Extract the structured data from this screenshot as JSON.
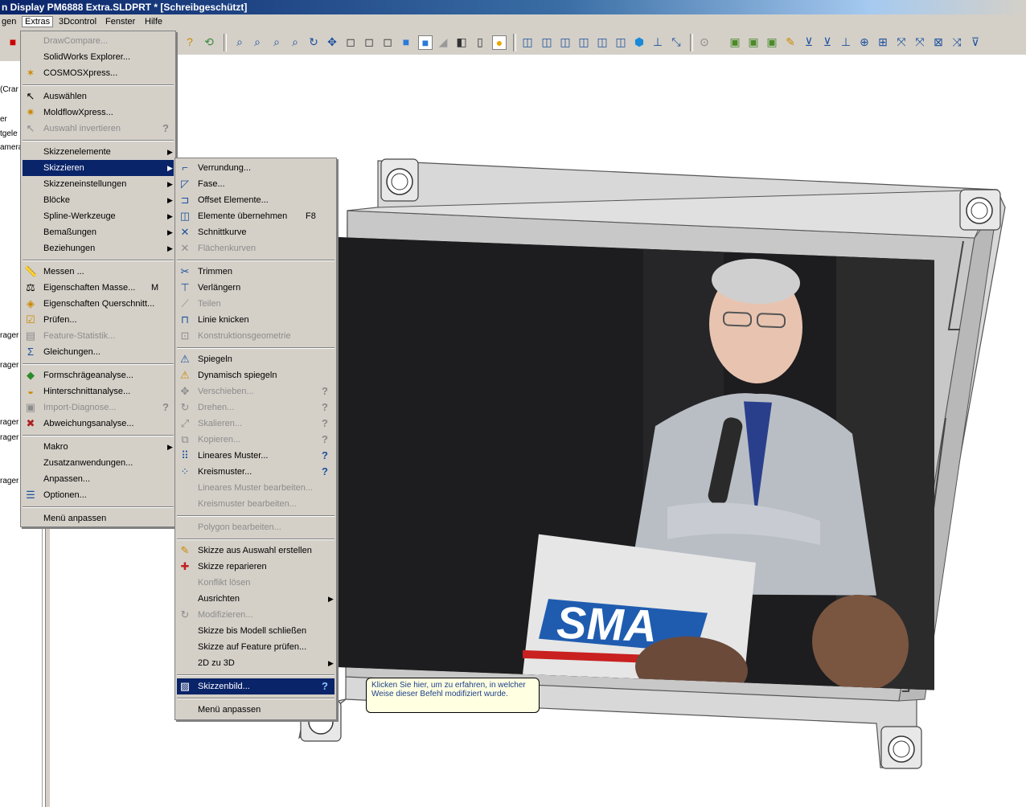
{
  "window": {
    "title": "n Display PM6888 Extra.SLDPRT * [Schreibgeschützt]"
  },
  "menubar": {
    "items": [
      "gen",
      "Extras",
      "3Dcontrol",
      "Fenster",
      "Hilfe"
    ]
  },
  "leftpanel": {
    "items": [
      "(Crar",
      "er",
      "tgele",
      "amera",
      "rager",
      "rager",
      "rager",
      "rager",
      "rager"
    ]
  },
  "extras_menu": {
    "items": [
      {
        "label": "DrawCompare...",
        "disabled": true
      },
      {
        "label": "SolidWorks Explorer..."
      },
      {
        "label": "COSMOSXpress..."
      },
      {
        "label": "Auswählen"
      },
      {
        "label": "MoldflowXpress..."
      },
      {
        "label": "Auswahl invertieren",
        "disabled": true
      },
      {
        "label": "Skizzenelemente"
      },
      {
        "label": "Skizzieren",
        "selected": true
      },
      {
        "label": "Skizzeneinstellungen"
      },
      {
        "label": "Blöcke"
      },
      {
        "label": "Spline-Werkzeuge"
      },
      {
        "label": "Bemaßungen"
      },
      {
        "label": "Beziehungen"
      },
      {
        "label": "Messen ..."
      },
      {
        "label": "Eigenschaften Masse...",
        "shortcut": "M"
      },
      {
        "label": "Eigenschaften Querschnitt..."
      },
      {
        "label": "Prüfen..."
      },
      {
        "label": "Feature-Statistik...",
        "disabled": true
      },
      {
        "label": "Gleichungen..."
      },
      {
        "label": "Formschrägeanalyse..."
      },
      {
        "label": "Hinterschnittanalyse..."
      },
      {
        "label": "Import-Diagnose...",
        "disabled": true
      },
      {
        "label": "Abweichungsanalyse..."
      },
      {
        "label": "Makro"
      },
      {
        "label": "Zusatzanwendungen..."
      },
      {
        "label": "Anpassen..."
      },
      {
        "label": "Optionen..."
      },
      {
        "label": "Menü anpassen"
      }
    ]
  },
  "skizzieren_menu": {
    "items": [
      {
        "label": "Verrundung..."
      },
      {
        "label": "Fase..."
      },
      {
        "label": "Offset Elemente..."
      },
      {
        "label": "Elemente übernehmen",
        "shortcut": "F8"
      },
      {
        "label": "Schnittkurve"
      },
      {
        "label": "Flächenkurven",
        "disabled": true
      },
      {
        "label": "Trimmen"
      },
      {
        "label": "Verlängern"
      },
      {
        "label": "Teilen",
        "disabled": true
      },
      {
        "label": "Linie knicken"
      },
      {
        "label": "Konstruktionsgeometrie",
        "disabled": true
      },
      {
        "label": "Spiegeln"
      },
      {
        "label": "Dynamisch spiegeln"
      },
      {
        "label": "Verschieben...",
        "disabled": true
      },
      {
        "label": "Drehen...",
        "disabled": true
      },
      {
        "label": "Skalieren...",
        "disabled": true
      },
      {
        "label": "Kopieren...",
        "disabled": true
      },
      {
        "label": "Lineares Muster..."
      },
      {
        "label": "Kreismuster..."
      },
      {
        "label": "Lineares Muster bearbeiten...",
        "disabled": true
      },
      {
        "label": "Kreismuster bearbeiten...",
        "disabled": true
      },
      {
        "label": "Polygon bearbeiten...",
        "disabled": true
      },
      {
        "label": "Skizze aus Auswahl erstellen"
      },
      {
        "label": "Skizze reparieren"
      },
      {
        "label": "Konflikt lösen",
        "disabled": true
      },
      {
        "label": "Ausrichten"
      },
      {
        "label": "Modifizieren...",
        "disabled": true
      },
      {
        "label": "Skizze bis Modell schließen"
      },
      {
        "label": "Skizze auf Feature prüfen..."
      },
      {
        "label": "2D zu 3D"
      },
      {
        "label": "Skizzenbild...",
        "selected": true
      },
      {
        "label": "Menü anpassen"
      }
    ]
  },
  "tooltip": {
    "text": "Klicken Sie hier, um zu erfahren, in welcher Weise dieser Befehl modifiziert wurde."
  },
  "photo": {
    "logo_text": "SMA"
  },
  "colors": {
    "menu_bg": "#d4d0c8",
    "highlight": "#0a246a",
    "tooltip_bg": "#ffffe1"
  }
}
